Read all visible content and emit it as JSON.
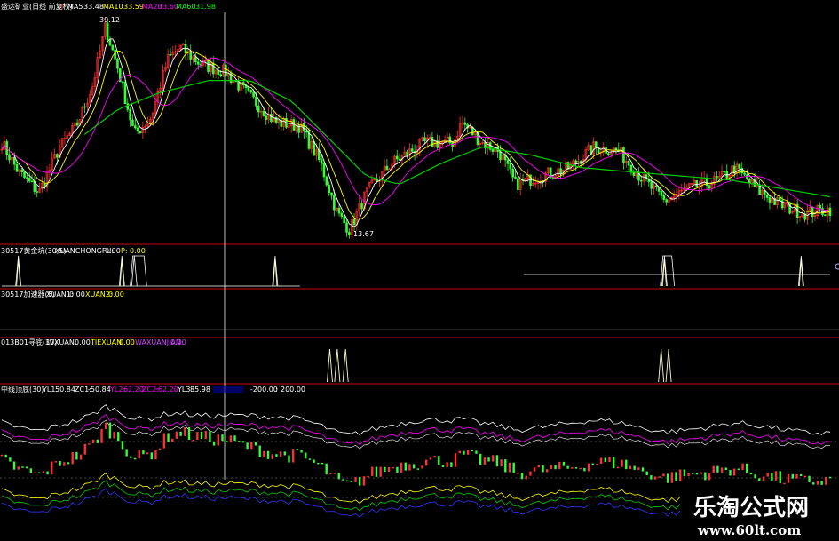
{
  "main_panel": {
    "title": "盛达矿业(日线 前复权)",
    "ma_legend": [
      {
        "label": "MA5",
        "value": "33.48",
        "color": "#ffffff"
      },
      {
        "label": "MA10",
        "value": "33.59",
        "color": "#ffff00"
      },
      {
        "label": "MA20",
        "value": "33.60",
        "color": "#ff00ff"
      },
      {
        "label": "MA60",
        "value": "31.98",
        "color": "#00ff00"
      }
    ],
    "high_label": "39.12",
    "low_label": "13.67",
    "wick_marker": "†"
  },
  "indicator_panels": [
    {
      "title": "30517黄金坑(30,5)",
      "fields": [
        {
          "label": "XUANCHONGFU:",
          "value": "0.00",
          "color": "#ffffff"
        },
        {
          "label": "P:",
          "value": "0.00",
          "color": "#ffff00"
        }
      ]
    },
    {
      "title": "30517加速器(5)",
      "fields": [
        {
          "label": "XUAN1:",
          "value": "0.00",
          "color": "#ffffff"
        },
        {
          "label": "XUAN2:",
          "value": "0.00",
          "color": "#ffff00"
        }
      ]
    },
    {
      "title": "013B01寻底(30)",
      "fields": [
        {
          "label": "LVXUAN:",
          "value": "0.00",
          "color": "#ffffff"
        },
        {
          "label": "TIEXUAN:",
          "value": "0.00",
          "color": "#ffff00"
        },
        {
          "label": "WAXUANJIAN:",
          "value": "0.00",
          "color": "#cc44ff"
        }
      ]
    },
    {
      "title": "中线顶底(30)",
      "fields": [
        {
          "label": "YL1:",
          "value": "50.84",
          "color": "#ffffff"
        },
        {
          "label": "ZC1:",
          "value": "-50.84",
          "color": "#ffffff"
        },
        {
          "label": "YL2:",
          "value": "62.20",
          "color": "#ff00ff"
        },
        {
          "label": "ZC2:",
          "value": "-62.20",
          "color": "#ff00ff"
        },
        {
          "label": "YL3:",
          "value": "85.98",
          "color": "#ffffff"
        },
        {
          "label": "",
          "value": "-200.00",
          "color": "#ffffff"
        },
        {
          "label": ":",
          "value": "200.00",
          "color": "#ffffff"
        }
      ]
    }
  ],
  "watermark": {
    "cn": "乐淘公式网",
    "en": "www.60lt.com"
  },
  "colors": {
    "background": "#000000",
    "up": "#ff3030",
    "down": "#33ff33",
    "divider": "#cc0000",
    "ma5": "#ffffff",
    "ma10": "#ffff00",
    "ma20": "#ff00ff",
    "ma60": "#00cc00",
    "signal": "#ffffcc"
  },
  "chart_data": {
    "type": "line",
    "price_axis": [
      13.67,
      39.12
    ],
    "close_profile": [
      {
        "x": 0.0,
        "y": 24.5
      },
      {
        "x": 0.02,
        "y": 21.0
      },
      {
        "x": 0.045,
        "y": 18.5
      },
      {
        "x": 0.07,
        "y": 24.0
      },
      {
        "x": 0.09,
        "y": 26.5
      },
      {
        "x": 0.11,
        "y": 31.5
      },
      {
        "x": 0.125,
        "y": 38.5
      },
      {
        "x": 0.14,
        "y": 33.5
      },
      {
        "x": 0.16,
        "y": 25.5
      },
      {
        "x": 0.18,
        "y": 27.5
      },
      {
        "x": 0.2,
        "y": 34.5
      },
      {
        "x": 0.215,
        "y": 36.0
      },
      {
        "x": 0.24,
        "y": 34.0
      },
      {
        "x": 0.27,
        "y": 33.0
      },
      {
        "x": 0.3,
        "y": 30.0
      },
      {
        "x": 0.33,
        "y": 27.0
      },
      {
        "x": 0.36,
        "y": 26.5
      },
      {
        "x": 0.385,
        "y": 22.0
      },
      {
        "x": 0.405,
        "y": 16.0
      },
      {
        "x": 0.42,
        "y": 14.0
      },
      {
        "x": 0.44,
        "y": 18.5
      },
      {
        "x": 0.47,
        "y": 22.0
      },
      {
        "x": 0.51,
        "y": 24.5
      },
      {
        "x": 0.545,
        "y": 24.5
      },
      {
        "x": 0.555,
        "y": 27.0
      },
      {
        "x": 0.58,
        "y": 24.5
      },
      {
        "x": 0.6,
        "y": 23.5
      },
      {
        "x": 0.62,
        "y": 19.5
      },
      {
        "x": 0.65,
        "y": 20.5
      },
      {
        "x": 0.685,
        "y": 21.5
      },
      {
        "x": 0.715,
        "y": 24.0
      },
      {
        "x": 0.745,
        "y": 23.5
      },
      {
        "x": 0.77,
        "y": 20.5
      },
      {
        "x": 0.8,
        "y": 17.5
      },
      {
        "x": 0.83,
        "y": 19.0
      },
      {
        "x": 0.865,
        "y": 20.0
      },
      {
        "x": 0.885,
        "y": 21.5
      },
      {
        "x": 0.91,
        "y": 19.0
      },
      {
        "x": 0.94,
        "y": 17.0
      },
      {
        "x": 0.97,
        "y": 16.0
      },
      {
        "x": 1.0,
        "y": 16.5
      }
    ],
    "ma60_profile": [
      {
        "x": 0.1,
        "y": 25.5
      },
      {
        "x": 0.14,
        "y": 28.5
      },
      {
        "x": 0.19,
        "y": 30.5
      },
      {
        "x": 0.25,
        "y": 32.0
      },
      {
        "x": 0.3,
        "y": 32.0
      },
      {
        "x": 0.35,
        "y": 29.5
      },
      {
        "x": 0.4,
        "y": 24.5
      },
      {
        "x": 0.44,
        "y": 20.5
      },
      {
        "x": 0.48,
        "y": 19.5
      },
      {
        "x": 0.53,
        "y": 22.0
      },
      {
        "x": 0.58,
        "y": 24.0
      },
      {
        "x": 0.64,
        "y": 23.0
      },
      {
        "x": 0.7,
        "y": 21.5
      },
      {
        "x": 0.76,
        "y": 21.0
      },
      {
        "x": 0.82,
        "y": 20.5
      },
      {
        "x": 0.88,
        "y": 20.0
      },
      {
        "x": 0.94,
        "y": 19.0
      },
      {
        "x": 1.0,
        "y": 18.0
      }
    ],
    "panel1_signals": {
      "white_spikes": [
        0.02,
        0.145,
        0.16,
        0.33,
        0.8,
        0.965
      ],
      "yellow_spikes": [
        0.02,
        0.145,
        0.33,
        0.8,
        0.965
      ],
      "white_blocks": [
        [
          0.155,
          0.175
        ],
        [
          0.795,
          0.812
        ]
      ]
    },
    "panel3_signals": {
      "yellow_spikes": [
        0.396,
        0.405,
        0.415,
        0.796,
        0.805
      ]
    }
  }
}
